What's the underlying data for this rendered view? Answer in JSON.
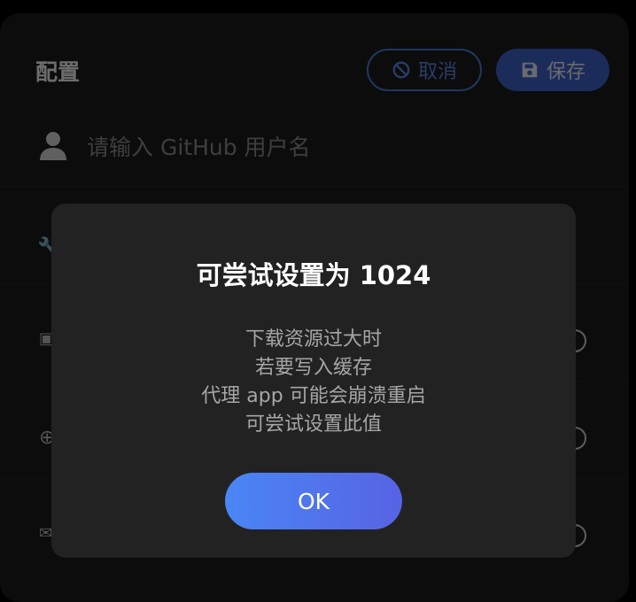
{
  "header": {
    "title": "配置",
    "cancel_label": "取消",
    "save_label": "保存"
  },
  "form": {
    "username_placeholder": "请输入 GitHub 用户名"
  },
  "dialog": {
    "title": "可尝试设置为 1024",
    "lines": [
      "下载资源过大时",
      "若要写入缓存",
      "代理 app 可能会崩溃重启",
      "可尝试设置此值"
    ],
    "ok_label": "OK"
  },
  "colors": {
    "accent": "#4b78d8",
    "save_bg": "#3f62c8",
    "ok_gradient_start": "#4a86f5",
    "ok_gradient_end": "#5763e4"
  },
  "icons": {
    "cancel": "ban-icon",
    "save": "floppy-disk-icon",
    "user": "user-icon"
  }
}
